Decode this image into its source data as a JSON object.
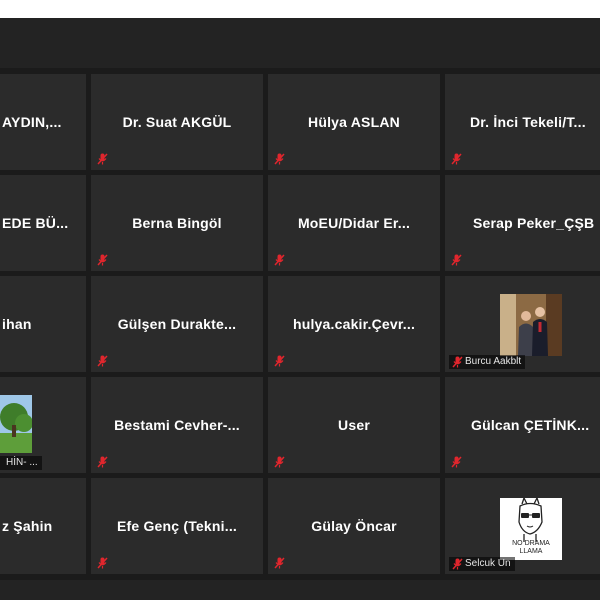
{
  "colors": {
    "tile": "#2b2b2b",
    "muted_icon": "#e0262d",
    "background": "#1f1f1f"
  },
  "tiles": [
    {
      "name": "AYDIN,...",
      "muted": false
    },
    {
      "name": "Dr. Suat AKGÜL",
      "muted": true
    },
    {
      "name": "Hülya ASLAN",
      "muted": true
    },
    {
      "name": "Dr. İnci Tekeli/T...",
      "muted": true
    },
    {
      "name": "EDE BÜ...",
      "muted": false
    },
    {
      "name": "Berna Bingöl",
      "muted": true
    },
    {
      "name": "MoEU/Didar Er...",
      "muted": true
    },
    {
      "name": "Serap Peker_ÇŞB",
      "muted": true
    },
    {
      "name": "ihan",
      "muted": false
    },
    {
      "name": "Gülşen Durakte...",
      "muted": true
    },
    {
      "name": "hulya.cakir.Çevr...",
      "muted": true
    },
    {
      "name": "Burcu Aakblt",
      "muted": true,
      "video": true
    },
    {
      "name": "HİN- ...",
      "muted": false,
      "video": true
    },
    {
      "name": "Bestami Cevher-...",
      "muted": true
    },
    {
      "name": "User",
      "muted": true
    },
    {
      "name": "Gülcan ÇETİNK...",
      "muted": true
    },
    {
      "name": "z Şahin",
      "muted": false
    },
    {
      "name": "Efe Genç (Tekni...",
      "muted": true
    },
    {
      "name": "Gülay Öncar",
      "muted": true
    },
    {
      "name": "Selcuk Un",
      "muted": true,
      "video": true
    }
  ],
  "llama_avatar": {
    "line1": "NO DRAMA",
    "line2": "LLAMA"
  },
  "icons": {
    "muted": "mic-muted-icon"
  }
}
